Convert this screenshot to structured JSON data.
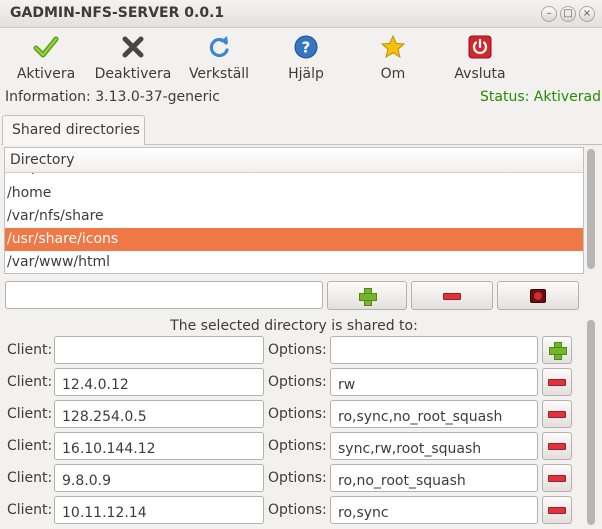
{
  "window": {
    "title": "GADMIN-NFS-SERVER 0.0.1",
    "controls": {
      "minimize": "–",
      "maximize": "□",
      "close": "×"
    }
  },
  "toolbar": {
    "items": [
      {
        "label": "Aktivera",
        "icon": "check-icon",
        "color": "#6fae22"
      },
      {
        "label": "Deaktivera",
        "icon": "x-icon",
        "color": "#4a4a4a"
      },
      {
        "label": "Verkställ",
        "icon": "refresh-icon",
        "color": "#3a87d2"
      },
      {
        "label": "Hjälp",
        "icon": "help-icon",
        "color": "#2f6fbd"
      },
      {
        "label": "Om",
        "icon": "star-icon",
        "color": "#f4c20d"
      },
      {
        "label": "Avsluta",
        "icon": "power-icon",
        "color": "#d3262e"
      }
    ]
  },
  "info": "Information: 3.13.0-37-generic",
  "status": {
    "text": "Status: Aktiverad",
    "color": "#2a8a00"
  },
  "tabs": [
    {
      "label": "Shared directories",
      "selected": true
    }
  ],
  "directories": {
    "column_header": "Directory",
    "items": [
      {
        "path": "/tmp",
        "selected": false
      },
      {
        "path": "/home",
        "selected": false
      },
      {
        "path": "/var/nfs/share",
        "selected": false
      },
      {
        "path": "/usr/share/icons",
        "selected": true
      },
      {
        "path": "/var/www/html",
        "selected": false
      }
    ],
    "selection_color": "#f07746",
    "new_directory_value": ""
  },
  "clients": {
    "heading": "The selected directory is shared to:",
    "client_label": "Client:",
    "options_label": "Options:",
    "rows": [
      {
        "client": "",
        "options": "",
        "action": "add"
      },
      {
        "client": "12.4.0.12",
        "options": "rw",
        "action": "remove"
      },
      {
        "client": "128.254.0.5",
        "options": "ro,sync,no_root_squash",
        "action": "remove"
      },
      {
        "client": "16.10.144.12",
        "options": "sync,rw,root_squash",
        "action": "remove"
      },
      {
        "client": "9.8.0.9",
        "options": "ro,no_root_squash",
        "action": "remove"
      },
      {
        "client": "10.11.12.14",
        "options": "ro,sync",
        "action": "remove"
      }
    ]
  }
}
